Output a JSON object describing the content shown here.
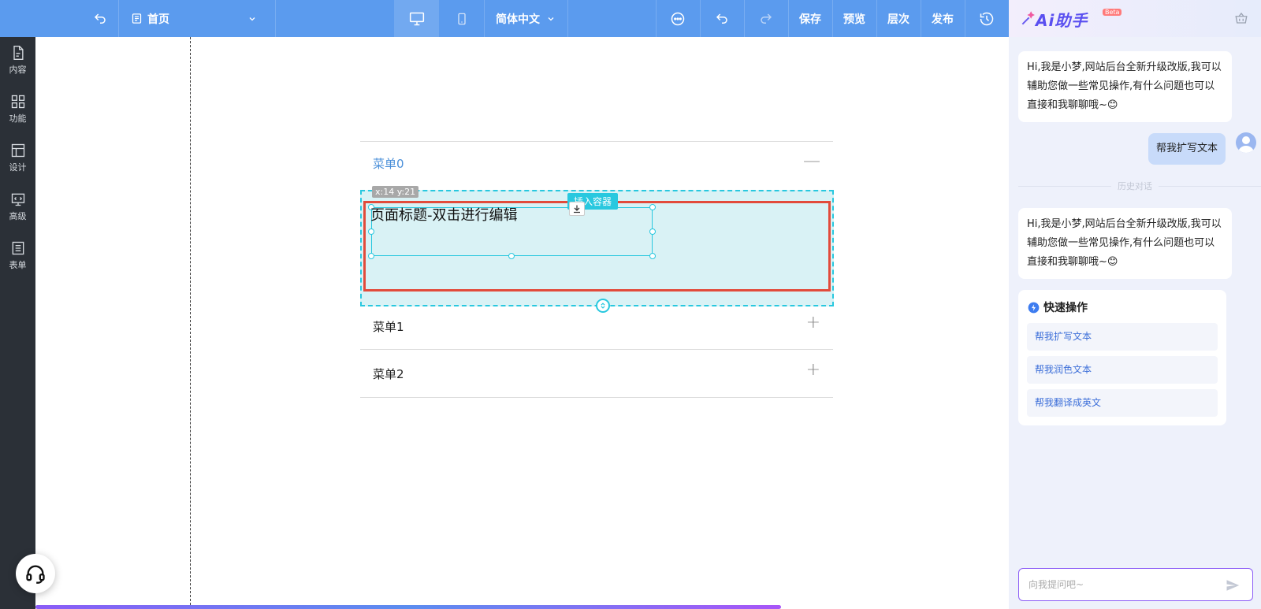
{
  "topbar": {
    "page_name": "首页",
    "language": "简体中文",
    "save": "保存",
    "preview": "预览",
    "layers": "层次",
    "publish": "发布"
  },
  "sidebar": {
    "items": [
      {
        "label": "内容",
        "icon": "document-icon"
      },
      {
        "label": "功能",
        "icon": "grid-icon"
      },
      {
        "label": "设计",
        "icon": "layout-icon"
      },
      {
        "label": "高级",
        "icon": "code-icon"
      },
      {
        "label": "表单",
        "icon": "form-icon"
      }
    ]
  },
  "canvas": {
    "menus": [
      {
        "label": "菜单0",
        "toggle": "—"
      },
      {
        "label": "菜单1",
        "toggle": "+"
      },
      {
        "label": "菜单2",
        "toggle": "+"
      }
    ],
    "coord_tag": "x:14 y:21",
    "insert_tag": "插入容器",
    "title_text": "页面标题-双击进行编辑"
  },
  "ai": {
    "title": "Ai助手",
    "beta": "Beta",
    "greeting": "Hi,我是小梦,网站后台全新升级改版,我可以辅助您做一些常见操作,有什么问题也可以直接和我聊聊哦~😊",
    "user_msg": "帮我扩写文本",
    "history_label": "历史对话",
    "greeting2": "Hi,我是小梦,网站后台全新升级改版,我可以辅助您做一些常见操作,有什么问题也可以直接和我聊聊哦~😊",
    "quick_title": "快速操作",
    "quick_items": [
      "帮我扩写文本",
      "帮我润色文本",
      "帮我翻译成英文"
    ],
    "input_placeholder": "向我提问吧~"
  },
  "colors": {
    "topbar": "#5b9bee",
    "sidebar": "#2b3037",
    "accent_cyan": "#29c8df",
    "highlight_red": "#e24b3b",
    "menu_active": "#4a8fd9"
  }
}
